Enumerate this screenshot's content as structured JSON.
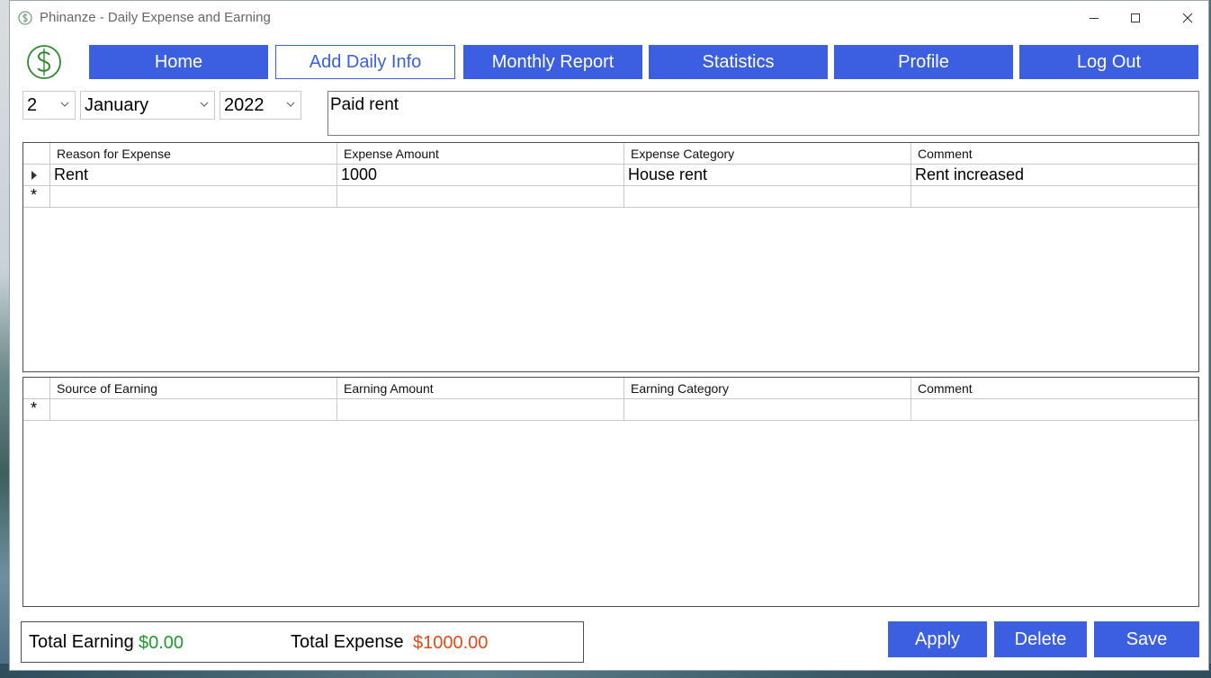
{
  "window": {
    "title": "Phinanze - Daily Expense and Earning"
  },
  "colors": {
    "accent": "#3b5fe0",
    "earning": "#1e9a2e",
    "expense": "#e04a1a",
    "logo": "#2f8a2f"
  },
  "icons": {
    "app": "dollar-circle-icon",
    "minimize": "minimize-icon",
    "maximize": "maximize-icon",
    "close": "close-icon",
    "dropdown": "chevron-down-icon",
    "row_current": "triangle-right-icon",
    "row_new": "asterisk-icon"
  },
  "nav": {
    "home": "Home",
    "add_daily": "Add Daily Info",
    "monthly": "Monthly Report",
    "statistics": "Statistics",
    "profile": "Profile",
    "logout": "Log Out"
  },
  "date": {
    "day": "2",
    "month": "January",
    "year": "2022"
  },
  "note": "Paid rent",
  "expense_table": {
    "headers": [
      "Reason for Expense",
      "Expense Amount",
      "Expense Category",
      "Comment"
    ],
    "rows": [
      {
        "reason": "Rent",
        "amount": "1000",
        "category": "House rent",
        "comment": "Rent increased"
      }
    ],
    "current_marker": "▶",
    "new_marker": "*"
  },
  "earning_table": {
    "headers": [
      "Source of Earning",
      "Earning Amount",
      "Earning Category",
      "Comment"
    ],
    "new_marker": "*"
  },
  "totals": {
    "earning_label": "Total Earning",
    "earning_value": "$0.00",
    "expense_label": "Total Expense",
    "expense_value": "$1000.00"
  },
  "actions": {
    "apply": "Apply",
    "delete": "Delete",
    "save": "Save"
  }
}
